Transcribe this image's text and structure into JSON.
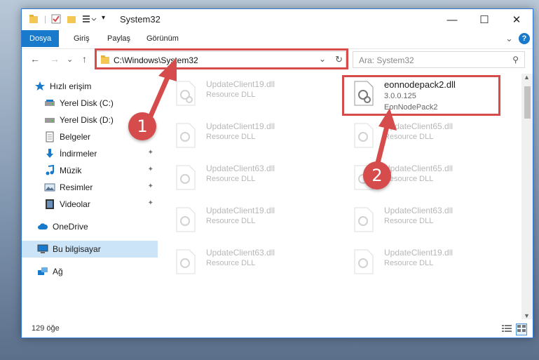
{
  "window": {
    "title": "System32",
    "minimize_glyph": "—",
    "maximize_glyph": "☐",
    "close_glyph": "✕"
  },
  "ribbon": {
    "tabs": [
      "Dosya",
      "Giriş",
      "Paylaş",
      "Görünüm"
    ],
    "help_glyph": "?",
    "expand_glyph": "⌄"
  },
  "navigation": {
    "back_glyph": "←",
    "forward_glyph": "→",
    "recent_glyph": "⌄",
    "up_glyph": "↑",
    "address": "C:\\Windows\\System32",
    "search_placeholder": "Ara: System32",
    "refresh_glyph": "↻",
    "search_icon_glyph": "⚲"
  },
  "sidebar": {
    "items": [
      {
        "label": "Hızlı erişim",
        "icon": "star-icon"
      },
      {
        "label": "Yerel Disk (C:)",
        "icon": "drive-icon"
      },
      {
        "label": "Yerel Disk (D:)",
        "icon": "drive-icon"
      },
      {
        "label": "Belgeler",
        "icon": "documents-icon"
      },
      {
        "label": "İndirmeler",
        "icon": "download-icon",
        "pinned": true
      },
      {
        "label": "Müzik",
        "icon": "music-icon",
        "pinned": true
      },
      {
        "label": "Resimler",
        "icon": "pictures-icon",
        "pinned": true
      },
      {
        "label": "Videolar",
        "icon": "videos-icon",
        "pinned": true
      },
      {
        "label": "OneDrive",
        "icon": "cloud-icon"
      },
      {
        "label": "Bu bilgisayar",
        "icon": "computer-icon",
        "selected": true
      },
      {
        "label": "Ağ",
        "icon": "network-icon"
      }
    ],
    "pin_glyph": "📌"
  },
  "files": [
    {
      "name": "UpdateClient19.dll",
      "type": "Resource DLL",
      "faded": true
    },
    {
      "name": "eonnodepack2.dll",
      "version": "3.0.0.125",
      "description": "EonNodePack2",
      "faded": false
    },
    {
      "name": "UpdateClient19.dll",
      "type": "Resource DLL",
      "faded": true
    },
    {
      "name": "UpdateClient65.dll",
      "type": "Resource DLL",
      "faded": true
    },
    {
      "name": "UpdateClient63.dll",
      "type": "Resource DLL",
      "faded": true
    },
    {
      "name": "UpdateClient65.dll",
      "type": "Resource DLL",
      "faded": true
    },
    {
      "name": "UpdateClient19.dll",
      "type": "Resource DLL",
      "faded": true
    },
    {
      "name": "UpdateClient63.dll",
      "type": "Resource DLL",
      "faded": true
    },
    {
      "name": "UpdateClient63.dll",
      "type": "Resource DLL",
      "faded": true
    },
    {
      "name": "UpdateClient19.dll",
      "type": "Resource DLL",
      "faded": true
    }
  ],
  "annotations": {
    "step1": "1",
    "step2": "2",
    "color": "#d64b4b"
  },
  "status": {
    "item_count": "129 öğe"
  }
}
